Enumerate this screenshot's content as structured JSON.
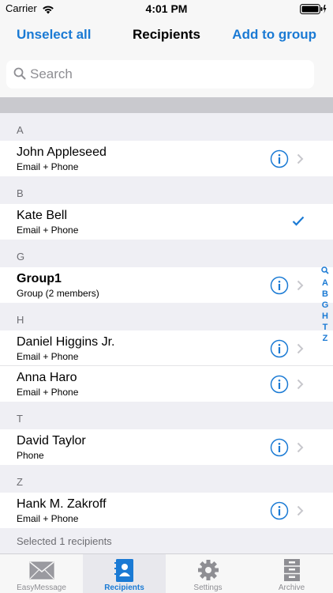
{
  "status_bar": {
    "carrier": "Carrier",
    "time": "4:01 PM"
  },
  "navbar": {
    "left_button": "Unselect all",
    "title": "Recipients",
    "right_button": "Add to group"
  },
  "search": {
    "placeholder": "Search"
  },
  "sections": [
    {
      "letter": "A",
      "rows": [
        {
          "name": "John Appleseed",
          "detail": "Email + Phone",
          "selected": false
        }
      ]
    },
    {
      "letter": "B",
      "rows": [
        {
          "name": "Kate Bell",
          "detail": "Email + Phone",
          "selected": true
        }
      ]
    },
    {
      "letter": "G",
      "rows": [
        {
          "name": "Group1",
          "detail": "Group (2 members)",
          "selected": false,
          "is_group": true
        }
      ]
    },
    {
      "letter": "H",
      "rows": [
        {
          "name": "Daniel Higgins Jr.",
          "detail": "Email + Phone",
          "selected": false
        },
        {
          "name": "Anna Haro",
          "detail": "Email + Phone",
          "selected": false
        }
      ]
    },
    {
      "letter": "T",
      "rows": [
        {
          "name": "David Taylor",
          "detail": "Phone",
          "selected": false
        }
      ]
    },
    {
      "letter": "Z",
      "rows": [
        {
          "name": "Hank M. Zakroff",
          "detail": "Email + Phone",
          "selected": false
        }
      ]
    }
  ],
  "footer": "Selected 1 recipients",
  "index_bar": [
    "A",
    "B",
    "G",
    "H",
    "T",
    "Z"
  ],
  "tabs": [
    {
      "label": "EasyMessage",
      "icon": "envelope-icon",
      "active": false
    },
    {
      "label": "Recipients",
      "icon": "contacts-book-icon",
      "active": true
    },
    {
      "label": "Settings",
      "icon": "gear-icon",
      "active": false
    },
    {
      "label": "Archive",
      "icon": "filing-cabinet-icon",
      "active": false
    }
  ],
  "colors": {
    "accent": "#1a7ad4",
    "inactive": "#8e8e93",
    "background": "#efeff4"
  }
}
